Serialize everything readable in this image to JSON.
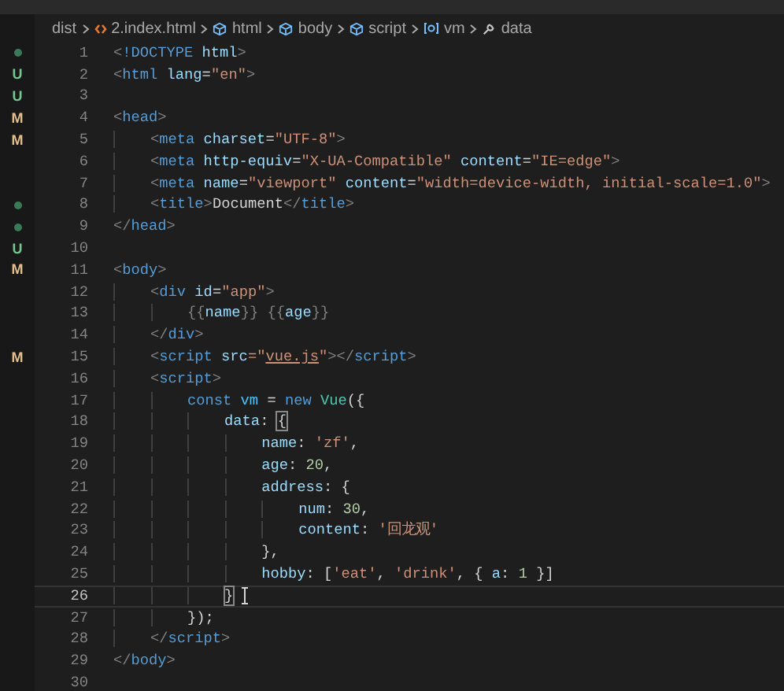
{
  "breadcrumb": [
    {
      "kind": "folder",
      "text": "dist"
    },
    {
      "kind": "html-file",
      "text": "2.index.html"
    },
    {
      "kind": "element",
      "text": "html"
    },
    {
      "kind": "element",
      "text": "body"
    },
    {
      "kind": "element",
      "text": "script"
    },
    {
      "kind": "variable",
      "text": "vm"
    },
    {
      "kind": "property",
      "text": "data"
    }
  ],
  "lines": [
    {
      "number": "1",
      "current": false,
      "git": {
        "kind": "dot",
        "color": "#3b7a57"
      },
      "tokens": [
        {
          "kind": "text",
          "t": "<",
          "color": "#808080"
        },
        {
          "kind": "text",
          "t": "!DOCTYPE",
          "color": "#569cd6"
        },
        {
          "kind": "text",
          "t": " html",
          "color": "#9cdcfe"
        },
        {
          "kind": "text",
          "t": ">",
          "color": "#808080"
        }
      ]
    },
    {
      "number": "2",
      "current": false,
      "git": {
        "kind": "letter",
        "text": "U",
        "color": "#73c991"
      },
      "tokens": [
        {
          "kind": "text",
          "t": "<",
          "color": "#808080"
        },
        {
          "kind": "text",
          "t": "html",
          "color": "#569cd6"
        },
        {
          "kind": "text",
          "t": " lang",
          "color": "#9cdcfe"
        },
        {
          "kind": "text",
          "t": "=",
          "color": "#d4d4d4"
        },
        {
          "kind": "text",
          "t": "\"en\"",
          "color": "#ce9178"
        },
        {
          "kind": "text",
          "t": ">",
          "color": "#808080"
        }
      ]
    },
    {
      "number": "3",
      "current": false,
      "git": {
        "kind": "letter",
        "text": "U",
        "color": "#73c991"
      }
    },
    {
      "number": "4",
      "current": false,
      "git": {
        "kind": "letter",
        "text": "M",
        "color": "#e2c08d"
      },
      "tokens": [
        {
          "kind": "text",
          "t": "<",
          "color": "#808080"
        },
        {
          "kind": "text",
          "t": "head",
          "color": "#569cd6"
        },
        {
          "kind": "text",
          "t": ">",
          "color": "#808080"
        }
      ]
    },
    {
      "number": "5",
      "current": false,
      "git": {
        "kind": "letter",
        "text": "M",
        "color": "#e2c08d"
      },
      "tokens": [
        {
          "kind": "text",
          "t": "    <",
          "color": "#808080"
        },
        {
          "kind": "text",
          "t": "meta",
          "color": "#569cd6"
        },
        {
          "kind": "text",
          "t": " charset",
          "color": "#9cdcfe"
        },
        {
          "kind": "text",
          "t": "=",
          "color": "#d4d4d4"
        },
        {
          "kind": "text",
          "t": "\"UTF-8\"",
          "color": "#ce9178"
        },
        {
          "kind": "text",
          "t": ">",
          "color": "#808080"
        }
      ]
    },
    {
      "number": "6",
      "current": false,
      "tokens": [
        {
          "kind": "text",
          "t": "    <",
          "color": "#808080"
        },
        {
          "kind": "text",
          "t": "meta",
          "color": "#569cd6"
        },
        {
          "kind": "text",
          "t": " http-equiv",
          "color": "#9cdcfe"
        },
        {
          "kind": "text",
          "t": "=",
          "color": "#d4d4d4"
        },
        {
          "kind": "text",
          "t": "\"X-UA-Compatible\"",
          "color": "#ce9178"
        },
        {
          "kind": "text",
          "t": " content",
          "color": "#9cdcfe"
        },
        {
          "kind": "text",
          "t": "=",
          "color": "#d4d4d4"
        },
        {
          "kind": "text",
          "t": "\"IE=edge\"",
          "color": "#ce9178"
        },
        {
          "kind": "text",
          "t": ">",
          "color": "#808080"
        }
      ]
    },
    {
      "number": "7",
      "current": false,
      "tokens": [
        {
          "kind": "text",
          "t": "    <",
          "color": "#808080"
        },
        {
          "kind": "text",
          "t": "meta",
          "color": "#569cd6"
        },
        {
          "kind": "text",
          "t": " name",
          "color": "#9cdcfe"
        },
        {
          "kind": "text",
          "t": "=",
          "color": "#d4d4d4"
        },
        {
          "kind": "text",
          "t": "\"viewport\"",
          "color": "#ce9178"
        },
        {
          "kind": "text",
          "t": " content",
          "color": "#9cdcfe"
        },
        {
          "kind": "text",
          "t": "=",
          "color": "#d4d4d4"
        },
        {
          "kind": "text",
          "t": "\"width=device-width, initial-scale=1.0\"",
          "color": "#ce9178"
        },
        {
          "kind": "text",
          "t": ">",
          "color": "#808080"
        }
      ]
    },
    {
      "number": "8",
      "current": false,
      "git": {
        "kind": "dot",
        "color": "#3b7a57"
      },
      "tokens": [
        {
          "kind": "text",
          "t": "    <",
          "color": "#808080"
        },
        {
          "kind": "text",
          "t": "title",
          "color": "#569cd6"
        },
        {
          "kind": "text",
          "t": ">",
          "color": "#808080"
        },
        {
          "kind": "text",
          "t": "Document",
          "color": "#d4d4d4"
        },
        {
          "kind": "text",
          "t": "</",
          "color": "#808080"
        },
        {
          "kind": "text",
          "t": "title",
          "color": "#569cd6"
        },
        {
          "kind": "text",
          "t": ">",
          "color": "#808080"
        }
      ]
    },
    {
      "number": "9",
      "current": false,
      "git": {
        "kind": "dot",
        "color": "#3b7a57"
      },
      "tokens": [
        {
          "kind": "text",
          "t": "</",
          "color": "#808080"
        },
        {
          "kind": "text",
          "t": "head",
          "color": "#569cd6"
        },
        {
          "kind": "text",
          "t": ">",
          "color": "#808080"
        }
      ]
    },
    {
      "number": "10",
      "current": false,
      "git": {
        "kind": "letter",
        "text": "U",
        "color": "#73c991"
      }
    },
    {
      "number": "11",
      "current": false,
      "git": {
        "kind": "letter",
        "text": "M",
        "color": "#e2c08d"
      },
      "tokens": [
        {
          "kind": "text",
          "t": "<",
          "color": "#808080"
        },
        {
          "kind": "text",
          "t": "body",
          "color": "#569cd6"
        },
        {
          "kind": "text",
          "t": ">",
          "color": "#808080"
        }
      ]
    },
    {
      "number": "12",
      "current": false,
      "tokens": [
        {
          "kind": "text",
          "t": "    <",
          "color": "#808080"
        },
        {
          "kind": "text",
          "t": "div",
          "color": "#569cd6"
        },
        {
          "kind": "text",
          "t": " id",
          "color": "#9cdcfe"
        },
        {
          "kind": "text",
          "t": "=",
          "color": "#d4d4d4"
        },
        {
          "kind": "text",
          "t": "\"app\"",
          "color": "#ce9178"
        },
        {
          "kind": "text",
          "t": ">",
          "color": "#808080"
        }
      ]
    },
    {
      "number": "13",
      "current": false,
      "tokens": [
        {
          "kind": "text",
          "t": "        {{",
          "color": "#808080"
        },
        {
          "kind": "text",
          "t": "name",
          "color": "#9cdcfe"
        },
        {
          "kind": "text",
          "t": "}} {{",
          "color": "#808080"
        },
        {
          "kind": "text",
          "t": "age",
          "color": "#9cdcfe"
        },
        {
          "kind": "text",
          "t": "}}",
          "color": "#808080"
        }
      ]
    },
    {
      "number": "14",
      "current": false,
      "tokens": [
        {
          "kind": "text",
          "t": "    </",
          "color": "#808080"
        },
        {
          "kind": "text",
          "t": "div",
          "color": "#569cd6"
        },
        {
          "kind": "text",
          "t": ">",
          "color": "#808080"
        }
      ]
    },
    {
      "number": "15",
      "current": false,
      "git": {
        "kind": "letter",
        "text": "M",
        "color": "#e2c08d"
      },
      "tokens": [
        {
          "kind": "text",
          "t": "    <",
          "color": "#808080"
        },
        {
          "kind": "text",
          "t": "script",
          "color": "#569cd6"
        },
        {
          "kind": "text",
          "t": " src",
          "color": "#9cdcfe"
        },
        {
          "kind": "text",
          "t": "=\"",
          "color": "#ce9178"
        },
        {
          "kind": "link",
          "t": "vue.js",
          "color": "#ce9178"
        },
        {
          "kind": "text",
          "t": "\"",
          "color": "#ce9178"
        },
        {
          "kind": "text",
          "t": "></",
          "color": "#808080"
        },
        {
          "kind": "text",
          "t": "script",
          "color": "#569cd6"
        },
        {
          "kind": "text",
          "t": ">",
          "color": "#808080"
        }
      ]
    },
    {
      "number": "16",
      "current": false,
      "tokens": [
        {
          "kind": "text",
          "t": "    <",
          "color": "#808080"
        },
        {
          "kind": "text",
          "t": "script",
          "color": "#569cd6"
        },
        {
          "kind": "text",
          "t": ">",
          "color": "#808080"
        }
      ]
    },
    {
      "number": "17",
      "current": false,
      "tokens": [
        {
          "kind": "text",
          "t": "        const",
          "color": "#569cd6"
        },
        {
          "kind": "text",
          "t": " vm",
          "color": "#4fc1ff"
        },
        {
          "kind": "text",
          "t": " = ",
          "color": "#d4d4d4"
        },
        {
          "kind": "text",
          "t": "new",
          "color": "#569cd6"
        },
        {
          "kind": "text",
          "t": " Vue",
          "color": "#4ec9b0"
        },
        {
          "kind": "text",
          "t": "({",
          "color": "#d4d4d4"
        }
      ]
    },
    {
      "number": "18",
      "current": false,
      "tokens": [
        {
          "kind": "text",
          "t": "            data",
          "color": "#9cdcfe"
        },
        {
          "kind": "text",
          "t": ": ",
          "color": "#d4d4d4"
        },
        {
          "kind": "match",
          "t": "{",
          "color": "#d4d4d4"
        }
      ]
    },
    {
      "number": "19",
      "current": false,
      "tokens": [
        {
          "kind": "text",
          "t": "                name",
          "color": "#9cdcfe"
        },
        {
          "kind": "text",
          "t": ": ",
          "color": "#d4d4d4"
        },
        {
          "kind": "text",
          "t": "'zf'",
          "color": "#ce9178"
        },
        {
          "kind": "text",
          "t": ",",
          "color": "#d4d4d4"
        }
      ]
    },
    {
      "number": "20",
      "current": false,
      "tokens": [
        {
          "kind": "text",
          "t": "                age",
          "color": "#9cdcfe"
        },
        {
          "kind": "text",
          "t": ": ",
          "color": "#d4d4d4"
        },
        {
          "kind": "text",
          "t": "20",
          "color": "#b5cea8"
        },
        {
          "kind": "text",
          "t": ",",
          "color": "#d4d4d4"
        }
      ]
    },
    {
      "number": "21",
      "current": false,
      "tokens": [
        {
          "kind": "text",
          "t": "                address",
          "color": "#9cdcfe"
        },
        {
          "kind": "text",
          "t": ": {",
          "color": "#d4d4d4"
        }
      ]
    },
    {
      "number": "22",
      "current": false,
      "tokens": [
        {
          "kind": "text",
          "t": "                    num",
          "color": "#9cdcfe"
        },
        {
          "kind": "text",
          "t": ": ",
          "color": "#d4d4d4"
        },
        {
          "kind": "text",
          "t": "30",
          "color": "#b5cea8"
        },
        {
          "kind": "text",
          "t": ",",
          "color": "#d4d4d4"
        }
      ]
    },
    {
      "number": "23",
      "current": false,
      "tokens": [
        {
          "kind": "text",
          "t": "                    content",
          "color": "#9cdcfe"
        },
        {
          "kind": "text",
          "t": ": ",
          "color": "#d4d4d4"
        },
        {
          "kind": "text",
          "t": "'回龙观'",
          "color": "#ce9178"
        }
      ]
    },
    {
      "number": "24",
      "current": false,
      "tokens": [
        {
          "kind": "text",
          "t": "                },",
          "color": "#d4d4d4"
        }
      ]
    },
    {
      "number": "25",
      "current": false,
      "tokens": [
        {
          "kind": "text",
          "t": "                hobby",
          "color": "#9cdcfe"
        },
        {
          "kind": "text",
          "t": ": [",
          "color": "#d4d4d4"
        },
        {
          "kind": "text",
          "t": "'eat'",
          "color": "#ce9178"
        },
        {
          "kind": "text",
          "t": ", ",
          "color": "#d4d4d4"
        },
        {
          "kind": "text",
          "t": "'drink'",
          "color": "#ce9178"
        },
        {
          "kind": "text",
          "t": ", { ",
          "color": "#d4d4d4"
        },
        {
          "kind": "text",
          "t": "a",
          "color": "#9cdcfe"
        },
        {
          "kind": "text",
          "t": ": ",
          "color": "#d4d4d4"
        },
        {
          "kind": "text",
          "t": "1",
          "color": "#b5cea8"
        },
        {
          "kind": "text",
          "t": " }]",
          "color": "#d4d4d4"
        }
      ]
    },
    {
      "number": "26",
      "current": true,
      "tokens": [
        {
          "kind": "match",
          "t": "            }",
          "color": "#d4d4d4"
        }
      ]
    },
    {
      "number": "27",
      "current": false,
      "tokens": [
        {
          "kind": "text",
          "t": "        });",
          "color": "#d4d4d4"
        }
      ]
    },
    {
      "number": "28",
      "current": false,
      "tokens": [
        {
          "kind": "text",
          "t": "    </",
          "color": "#808080"
        },
        {
          "kind": "text",
          "t": "script",
          "color": "#569cd6"
        },
        {
          "kind": "text",
          "t": ">",
          "color": "#808080"
        }
      ]
    },
    {
      "number": "29",
      "current": false,
      "tokens": [
        {
          "kind": "text",
          "t": "</",
          "color": "#808080"
        },
        {
          "kind": "text",
          "t": "body",
          "color": "#569cd6"
        },
        {
          "kind": "text",
          "t": ">",
          "color": "#808080"
        }
      ]
    },
    {
      "number": "30",
      "current": false
    }
  ]
}
